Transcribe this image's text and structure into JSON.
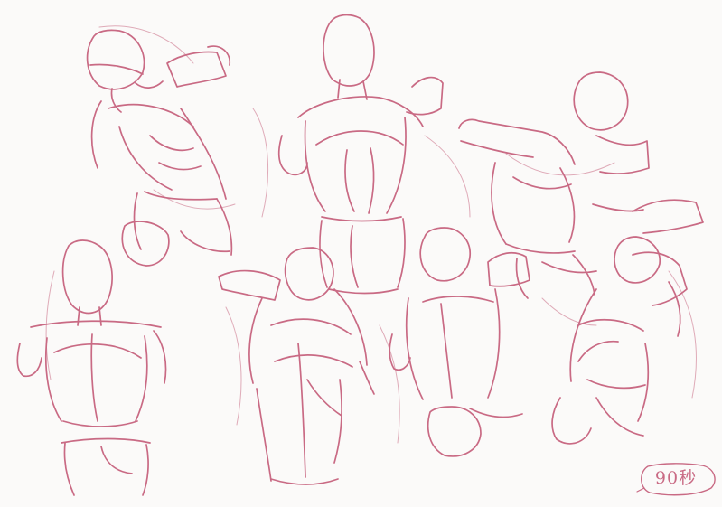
{
  "sheet": {
    "paper_color": "#fbfaf9",
    "pencil_color": "#c96a84"
  },
  "annotation": {
    "time_label": "90秒"
  },
  "figures": [
    "torso-sketch-top-left",
    "torso-sketch-top-center",
    "torso-sketch-top-right",
    "torso-sketch-bottom-left",
    "torso-sketch-bottom-center-left",
    "torso-sketch-bottom-center-right",
    "torso-sketch-bottom-right"
  ]
}
